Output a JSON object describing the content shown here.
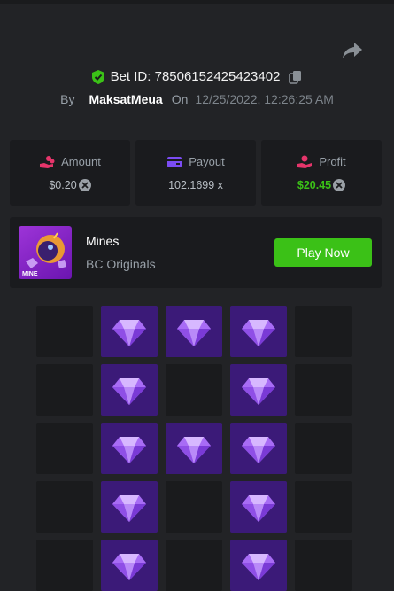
{
  "bet": {
    "id_label": "Bet ID: 78506152425423402",
    "by_label": "By",
    "user": "MaksatMeua",
    "on_label": "On",
    "date": "12/25/2022, 12:26:25 AM"
  },
  "stats": [
    {
      "label": "Amount",
      "value": "$0.20",
      "icon": "coins-hand-icon",
      "color": "#e6356b"
    },
    {
      "label": "Payout",
      "value": "102.1699 x",
      "icon": "card-icon",
      "color": "#7b4cf3"
    },
    {
      "label": "Profit",
      "value": "$20.45",
      "icon": "profit-hand-icon",
      "color": "#e6356b"
    }
  ],
  "game": {
    "name": "Mines",
    "provider": "BC Originals",
    "thumb_label": "MINE",
    "play_label": "Play Now"
  },
  "board": {
    "rows": [
      [
        "empty",
        "gem",
        "gem",
        "gem",
        "empty"
      ],
      [
        "empty",
        "gem",
        "empty",
        "gem",
        "empty"
      ],
      [
        "empty",
        "gem",
        "gem",
        "gem",
        "empty"
      ],
      [
        "empty",
        "gem",
        "empty",
        "gem",
        "empty"
      ],
      [
        "empty",
        "gem",
        "empty",
        "gem",
        "empty"
      ]
    ]
  },
  "colors": {
    "accent_green": "#3bc117",
    "gem_bg": "#3b1a78",
    "gem": "#a86cf5"
  }
}
